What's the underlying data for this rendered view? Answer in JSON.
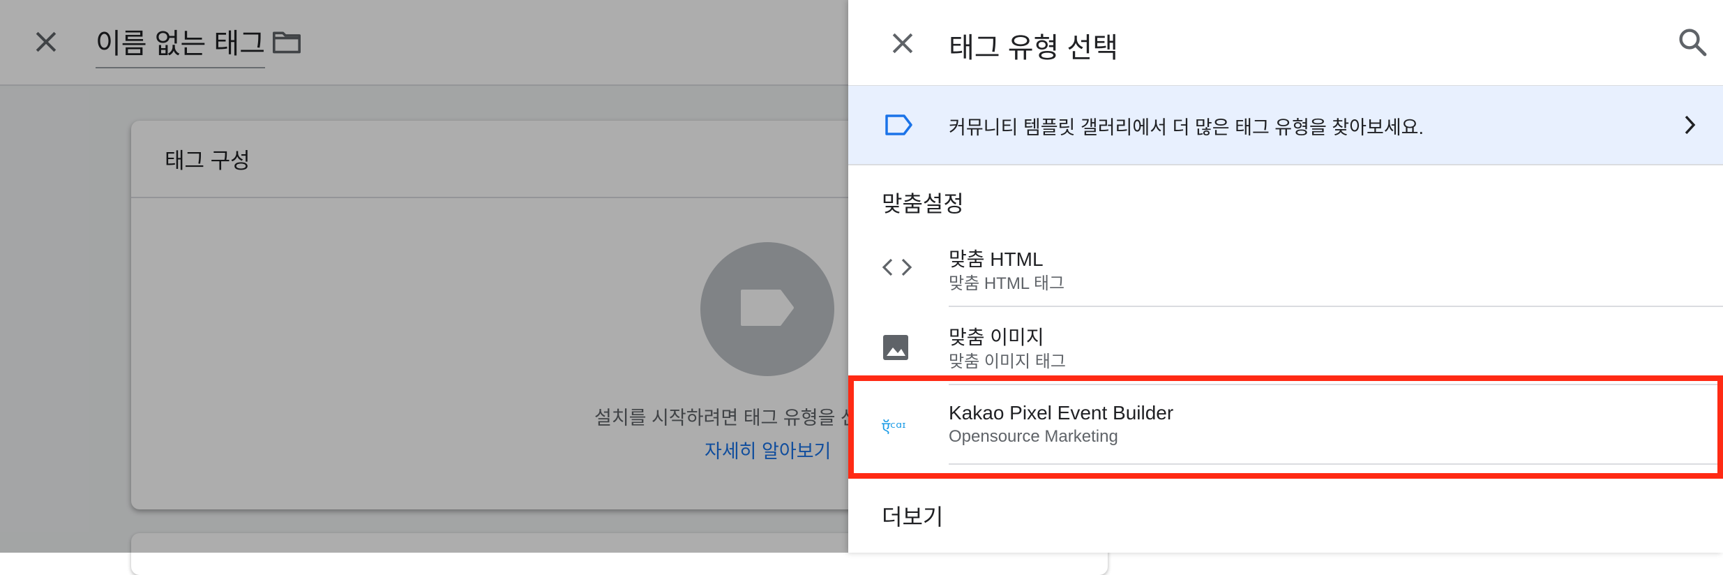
{
  "background": {
    "title": "이름 없는 태그",
    "card_title": "태그 구성",
    "card_description": "설치를 시작하려면 태그 유형을 선",
    "card_link": "자세히 알아보기"
  },
  "panel": {
    "title": "태그 유형 선택",
    "banner_text": "커뮤니티 템플릿 갤러리에서 더 많은 태그 유형을 찾아보세요.",
    "section_custom": "맞춤설정",
    "items": [
      {
        "name": "맞춤 HTML",
        "subtitle": "맞춤 HTML 태그",
        "icon": "code-icon"
      },
      {
        "name": "맞춤 이미지",
        "subtitle": "맞춤 이미지 태그",
        "icon": "image-icon"
      },
      {
        "name": "Kakao Pixel Event Builder",
        "subtitle": "Opensource Marketing",
        "icon": "kakao-logo-icon",
        "logo_text": "ऍᶜᵅᶦ"
      }
    ],
    "section_more": "더보기"
  },
  "colors": {
    "accent_blue": "#1a73e8",
    "banner_bg": "#e8f0fe",
    "highlight_red": "#ff2a14",
    "kakao_logo": "#1a9be6"
  }
}
